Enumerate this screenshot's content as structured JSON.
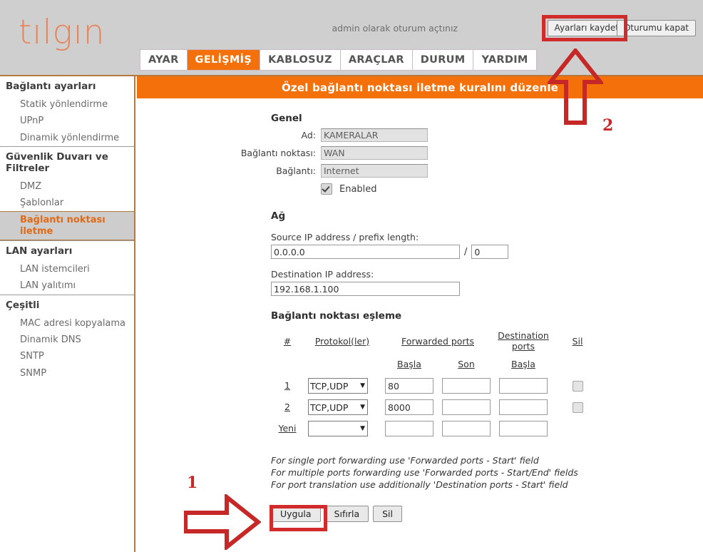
{
  "header": {
    "logo_text": "tılgın",
    "session_text": "admin olarak oturum açtınız",
    "save_settings_label": "Ayarları kaydet",
    "logout_label": "Oturumu kapat"
  },
  "nav": {
    "tabs": [
      {
        "label": "AYAR",
        "active": false
      },
      {
        "label": "GELİŞMİŞ",
        "active": true
      },
      {
        "label": "KABLOSUZ",
        "active": false
      },
      {
        "label": "ARAÇLAR",
        "active": false
      },
      {
        "label": "DURUM",
        "active": false
      },
      {
        "label": "YARDIM",
        "active": false
      }
    ]
  },
  "sidebar": {
    "groups": [
      {
        "head": "Bağlantı ayarları",
        "items": [
          {
            "label": "Statik yönlendirme",
            "active": false
          },
          {
            "label": "UPnP",
            "active": false
          },
          {
            "label": "Dinamik yönlendirme",
            "active": false
          }
        ]
      },
      {
        "head": "Güvenlik Duvarı ve Filtreler",
        "items": [
          {
            "label": "DMZ",
            "active": false
          },
          {
            "label": "Şablonlar",
            "active": false
          },
          {
            "label": "Bağlantı noktası iletme",
            "active": true
          }
        ]
      },
      {
        "head": "LAN ayarları",
        "items": [
          {
            "label": "LAN istemcileri",
            "active": false
          },
          {
            "label": "LAN yalıtımı",
            "active": false
          }
        ]
      },
      {
        "head": "Çeşitli",
        "items": [
          {
            "label": "MAC adresi kopyalama",
            "active": false
          },
          {
            "label": "Dinamik DNS",
            "active": false
          },
          {
            "label": "SNTP",
            "active": false
          },
          {
            "label": "SNMP",
            "active": false
          }
        ]
      }
    ]
  },
  "content": {
    "banner_title": "Özel bağlantı noktası iletme kuralını düzenle",
    "general": {
      "section_title": "Genel",
      "fields": [
        {
          "label": "Ad:",
          "value": "KAMERALAR"
        },
        {
          "label": "Bağlantı noktası:",
          "value": "WAN"
        },
        {
          "label": "Bağlantı:",
          "value": "Internet"
        }
      ],
      "enabled_label": "Enabled",
      "enabled_checked": true
    },
    "network": {
      "section_title": "Ağ",
      "source_label": "Source IP address / prefix length:",
      "source_ip": "0.0.0.0",
      "prefix_separator": "/",
      "prefix_length": "0",
      "destination_label": "Destination IP address:",
      "destination_ip": "192.168.1.100"
    },
    "port_mapping": {
      "section_title": "Bağlantı noktası eşleme",
      "headers": {
        "index": "#",
        "protocol": "Protokol(ler)",
        "forwarded_ports": "Forwarded ports",
        "destination_ports": "Destination ports",
        "delete": "Sil"
      },
      "subheaders": {
        "forwarded_start": "Başla",
        "forwarded_end": "Son",
        "destination_start": "Başla"
      },
      "rows": [
        {
          "index": "1",
          "protocol": "TCP,UDP",
          "forwarded_start": "80",
          "forwarded_end": "",
          "destination_start": "",
          "delete_checked": false
        },
        {
          "index": "2",
          "protocol": "TCP,UDP",
          "forwarded_start": "8000",
          "forwarded_end": "",
          "destination_start": "",
          "delete_checked": false
        },
        {
          "index": "Yeni",
          "protocol": "",
          "forwarded_start": "",
          "forwarded_end": "",
          "destination_start": "",
          "delete_checked": null
        }
      ]
    },
    "help_lines": [
      "For single port forwarding use 'Forwarded ports - Start' field",
      "For multiple ports forwarding use 'Forwarded ports - Start/End' fields",
      "For port translation use additionally 'Destination ports - Start' field"
    ],
    "buttons": {
      "apply": "Uygula",
      "reset": "Sıfırla",
      "delete": "Sil"
    }
  },
  "annotations": {
    "step1_number": "1",
    "step2_number": "2"
  },
  "colors": {
    "brand_orange": "#f4700a",
    "logo_orange": "#e8855c",
    "header_gray": "#cfcfcf",
    "annotation_red": "#d22b2b",
    "frame_brown": "#b5793f"
  }
}
